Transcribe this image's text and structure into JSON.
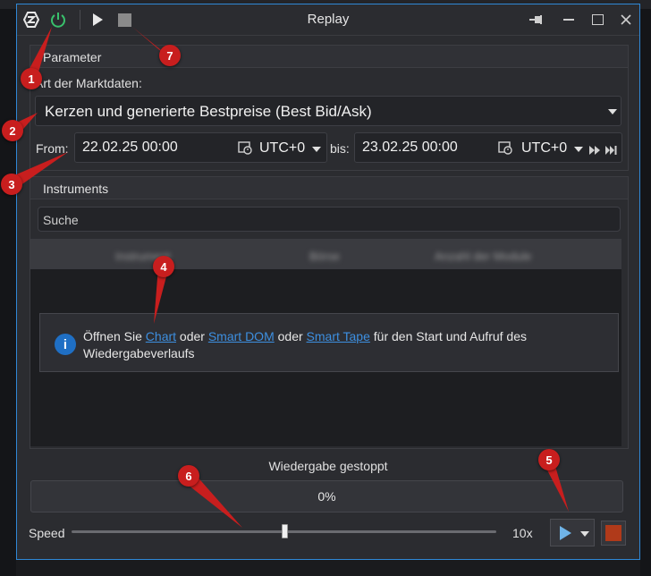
{
  "window": {
    "title": "Replay"
  },
  "parameter": {
    "heading": "Parameter",
    "data_type_label": "Art der Marktdaten:",
    "data_type_value": "Kerzen und generierte Bestpreise (Best Bid/Ask)",
    "from_label": "From:",
    "from_value": "22.02.25 00:00",
    "from_tz": "UTC+0",
    "to_label": "bis:",
    "to_value": "23.02.25 00:00",
    "to_tz": "UTC+0"
  },
  "instruments": {
    "heading": "Instruments",
    "search_placeholder": "Suche",
    "columns": [
      "Instrument",
      "Börse",
      "Anzahl der Module"
    ]
  },
  "info": {
    "text_1": "Öffnen Sie ",
    "link_chart": "Chart",
    "text_2": " oder ",
    "link_dom": "Smart DOM",
    "text_3": " oder ",
    "link_tape": "Smart Tape",
    "text_4": " für den Start und Aufruf des",
    "text_5": "Wiedergabeverlaufs"
  },
  "playback": {
    "status": "Wiedergabe gestoppt",
    "progress_text": "0%",
    "progress": 0,
    "speed_label": "Speed",
    "speed_value": "10x",
    "slider_position": 0.5
  },
  "markers": [
    "1",
    "2",
    "3",
    "4",
    "5",
    "6",
    "7"
  ],
  "colors": {
    "accent": "#2f88d6",
    "power": "#39c16c",
    "marker": "#c81e1e",
    "stop": "#b03a1a",
    "link": "#3d8fe0"
  }
}
